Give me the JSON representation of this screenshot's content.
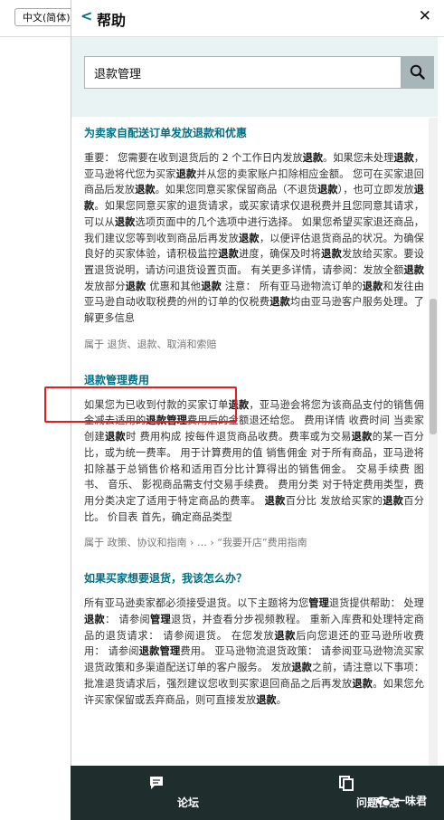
{
  "background": {
    "language_select": "中文(简体)"
  },
  "panel": {
    "back_glyph": "<",
    "title": "帮助",
    "close_glyph": "✕",
    "search": {
      "value": "退款管理"
    }
  },
  "results": [
    {
      "title": "为卖家自配送订单发放退款和优惠",
      "body": [
        {
          "t": "重要： 您需要在收到退货后的 2 个工作日内发放"
        },
        {
          "b": "退款"
        },
        {
          "t": "。如果您未处理"
        },
        {
          "b": "退款"
        },
        {
          "t": "，亚马逊将代您为买家"
        },
        {
          "b": "退款"
        },
        {
          "t": "并从您的卖家账户扣除相应金额。 您可在买家退回商品后发放"
        },
        {
          "b": "退款"
        },
        {
          "t": "。如果您同意买家保留商品（不退货"
        },
        {
          "b": "退款"
        },
        {
          "t": "），也可立即发放"
        },
        {
          "b": "退款"
        },
        {
          "t": "。如果您同意买家的退货请求，或买家请求仅退税费并且您同意其请求，可以从"
        },
        {
          "b": "退款"
        },
        {
          "t": "选项页面中的几个选项中进行选择。 如果您希望买家退还商品，我们建议您等到收到商品后再发放"
        },
        {
          "b": "退款"
        },
        {
          "t": "，以便评估退货商品的状况。为确保良好的买家体验，请积极监控"
        },
        {
          "b": "退款"
        },
        {
          "t": "进度，确保及时将"
        },
        {
          "b": "退款"
        },
        {
          "t": "发放给买家。要设置退货说明，请访问退货设置页面。 有关更多详情，请参阅：发放全额"
        },
        {
          "b": "退款"
        },
        {
          "t": " 发放部分"
        },
        {
          "b": "退款"
        },
        {
          "t": " 优惠和其他"
        },
        {
          "b": "退款"
        },
        {
          "t": " 注意： 所有亚马逊物流订单的"
        },
        {
          "b": "退款"
        },
        {
          "t": "和发往由亚马逊自动收取税费的州的订单的仅税费"
        },
        {
          "b": "退款"
        },
        {
          "t": "均由亚马逊客户服务处理。了解更多信息"
        }
      ],
      "breadcrumb": "属于 退货、退款、取消和索赔"
    },
    {
      "title": "退款管理费用",
      "body": [
        {
          "t": "如果您为已收到付款的买家订单"
        },
        {
          "b": "退款"
        },
        {
          "t": "，亚马逊会将您为该商品支付的销售佣金减去适用的"
        },
        {
          "b": "退款管理"
        },
        {
          "t": "费用后的金额退还给您。 费用详情 收费时间 当卖家创建"
        },
        {
          "b": "退款"
        },
        {
          "t": "时 费用构成 按每件退货商品收费。费率或为交易"
        },
        {
          "b": "退款"
        },
        {
          "t": "的某一百分比，或为统一费率。 用于计算费用的值 销售佣金 对于所有商品，亚马逊将扣除基于总销售价格和适用百分比计算得出的销售佣金。 交易手续费 图书、 音乐、 影视商品需支付交易手续费。 费用分类 对于特定费用类型，费用分类决定了适用于特定商品的费率。 "
        },
        {
          "b": "退款"
        },
        {
          "t": "百分比 发放给买家的"
        },
        {
          "b": "退款"
        },
        {
          "t": "百分比。 价目表 首先，确定商品类型"
        }
      ],
      "breadcrumb": "属于 政策、协议和指南 › … › “我要开店”费用指南"
    },
    {
      "title": "如果买家想要退货，我该怎么办？",
      "body": [
        {
          "t": "所有亚马逊卖家都必须接受退货。以下主题将为您"
        },
        {
          "b": "管理"
        },
        {
          "t": "退货提供帮助： 处理"
        },
        {
          "b": "退款"
        },
        {
          "t": "： 请参阅"
        },
        {
          "b": "管理"
        },
        {
          "t": "退货，并查看分步视频教程。 重新入库费和处理特定商品的退货请求： 请参阅退货。 在您发放"
        },
        {
          "b": "退款"
        },
        {
          "t": "后向您退还的亚马逊所收费用： 请参阅"
        },
        {
          "b": "退款管理"
        },
        {
          "t": "费用。 亚马逊物流退货政策： 请参阅亚马逊物流买家退货政策和多渠道配送订单的客户服务。 发放"
        },
        {
          "b": "退款"
        },
        {
          "t": "之前，请注意以下事项： 批准退货请求后，强烈建议您收到买家退回商品之后再发放"
        },
        {
          "b": "退款"
        },
        {
          "t": "。如果您允许买家保留或丢弃商品，则可直接发放"
        },
        {
          "b": "退款"
        },
        {
          "t": "。"
        }
      ],
      "breadcrumb": ""
    }
  ],
  "footer": {
    "forum_label": "论坛",
    "log_label": "问题日志",
    "watermark": "一味君"
  },
  "colors": {
    "link": "#007185",
    "footer_bg": "#1f2d2d",
    "search_bg": "#eaf3f3",
    "highlight": "#e02020"
  }
}
